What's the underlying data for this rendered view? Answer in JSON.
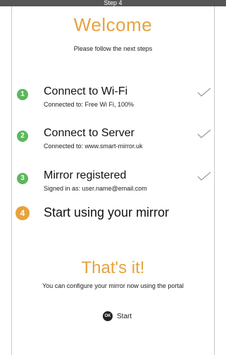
{
  "header": {
    "step_label": "Step 4"
  },
  "welcome": {
    "title": "Welcome",
    "subtitle": "Please follow the next steps"
  },
  "steps": [
    {
      "number": "1",
      "title": "Connect to Wi-Fi",
      "detail": "Connected to: Free Wi Fi, 100%",
      "status": "done",
      "icon": "checkmark-icon"
    },
    {
      "number": "2",
      "title": "Connect to Server",
      "detail": "Connected to: www.smart-mirror.uk",
      "status": "done",
      "icon": "checkmark-icon"
    },
    {
      "number": "3",
      "title": "Mirror registered",
      "detail": "Signed in as: user.name@email.com",
      "status": "done",
      "icon": "checkmark-icon"
    },
    {
      "number": "4",
      "title": "Start using your mirror",
      "status": "current"
    }
  ],
  "finish": {
    "title": "That's it!",
    "message": "You can configure your mirror now using the portal",
    "start_icon_label": "OK",
    "start_label": "Start"
  },
  "colors": {
    "accent": "#e8a23d",
    "done": "#5cb85c",
    "header_bg": "#555555",
    "check": "#9e9e9e"
  }
}
